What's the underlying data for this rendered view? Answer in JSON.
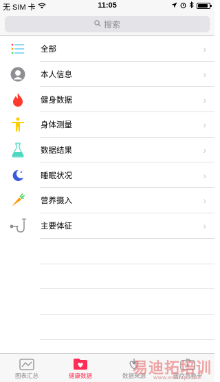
{
  "status_bar": {
    "carrier": "无 SIM 卡",
    "time": "11:05",
    "battery_level": 0.85
  },
  "search": {
    "placeholder": "搜索"
  },
  "categories": [
    {
      "label": "全部",
      "icon": "list-icon"
    },
    {
      "label": "本人信息",
      "icon": "person-icon"
    },
    {
      "label": "健身数据",
      "icon": "flame-icon"
    },
    {
      "label": "身体测量",
      "icon": "body-icon"
    },
    {
      "label": "数据结果",
      "icon": "flask-icon"
    },
    {
      "label": "睡眠状况",
      "icon": "moon-icon"
    },
    {
      "label": "营养摄入",
      "icon": "carrot-icon"
    },
    {
      "label": "主要体征",
      "icon": "stethoscope-icon"
    }
  ],
  "tabbar": {
    "tabs": [
      {
        "label": "图表汇总",
        "active": false
      },
      {
        "label": "健康数据",
        "active": true
      },
      {
        "label": "数据来源",
        "active": false
      },
      {
        "label": "医疗急救卡",
        "active": false
      }
    ]
  },
  "watermark": {
    "text": "易迪拓培训",
    "url": "www.edatop.com"
  },
  "colors": {
    "accent": "#ff2d55",
    "flame": "#ff3b30",
    "body": "#ffcc00",
    "flask": "#4cd9c0",
    "moon": "#3b5bdb",
    "carrot": "#ff9500"
  }
}
